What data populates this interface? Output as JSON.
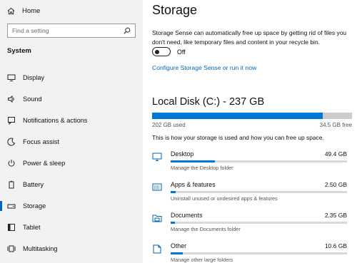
{
  "sidebar": {
    "home_label": "Home",
    "search_placeholder": "Find a setting",
    "section_title": "System",
    "items": [
      {
        "label": "Display",
        "icon": "display-icon"
      },
      {
        "label": "Sound",
        "icon": "sound-icon"
      },
      {
        "label": "Notifications & actions",
        "icon": "notifications-icon"
      },
      {
        "label": "Focus assist",
        "icon": "focus-assist-icon"
      },
      {
        "label": "Power & sleep",
        "icon": "power-icon"
      },
      {
        "label": "Battery",
        "icon": "battery-icon"
      },
      {
        "label": "Storage",
        "icon": "storage-icon",
        "active": true
      },
      {
        "label": "Tablet",
        "icon": "tablet-icon"
      },
      {
        "label": "Multitasking",
        "icon": "multitasking-icon"
      }
    ]
  },
  "main": {
    "title": "Storage",
    "description": "Storage Sense can automatically free up space by getting rid of files you don't need, like temporary files and content in your recycle bin.",
    "toggle_label": "Off",
    "toggle_state": "off",
    "configure_link": "Configure Storage Sense or run it now",
    "disk": {
      "title": "Local Disk (C:) - 237 GB",
      "used": "202 GB used",
      "free": "34.5 GB free",
      "used_fraction": 0.854,
      "info": "This is how your storage is used and how you can free up space."
    },
    "categories": [
      {
        "name": "Desktop",
        "size": "49.4 GB",
        "sub": "Manage the Desktop folder",
        "fraction": 0.25,
        "icon": "desktop-icon"
      },
      {
        "name": "Apps & features",
        "size": "2.50 GB",
        "sub": "Uninstall unused or undesired apps & features",
        "fraction": 0.03,
        "icon": "apps-icon"
      },
      {
        "name": "Documents",
        "size": "2.35 GB",
        "sub": "Manage the Documents folder",
        "fraction": 0.025,
        "icon": "documents-icon"
      },
      {
        "name": "Other",
        "size": "10.6 GB",
        "sub": "Manage other large folders",
        "fraction": 0.07,
        "icon": "other-icon"
      }
    ]
  },
  "colors": {
    "accent": "#0078d7",
    "link": "#0067b8",
    "sidebar_bg": "#f2f2f2"
  }
}
